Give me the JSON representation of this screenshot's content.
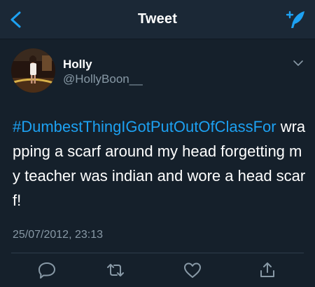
{
  "nav": {
    "title": "Tweet"
  },
  "user": {
    "name": "Holly",
    "handle": "@HollyBoon__"
  },
  "tweet": {
    "hashtag": "#DumbestThingIGotPutOutOfClassFor",
    "body": " wrapping a scarf around my head forgetting my teacher was indian and wore a head scarf!",
    "timestamp": "25/07/2012, 23:13"
  },
  "colors": {
    "accent": "#1da1f2",
    "background": "#15202b",
    "muted": "#8899a6"
  },
  "icons": {
    "back": "chevron-left-icon",
    "compose": "compose-tweet-icon",
    "more": "chevron-down-icon",
    "reply": "reply-icon",
    "retweet": "retweet-icon",
    "like": "heart-icon",
    "share": "share-icon"
  }
}
